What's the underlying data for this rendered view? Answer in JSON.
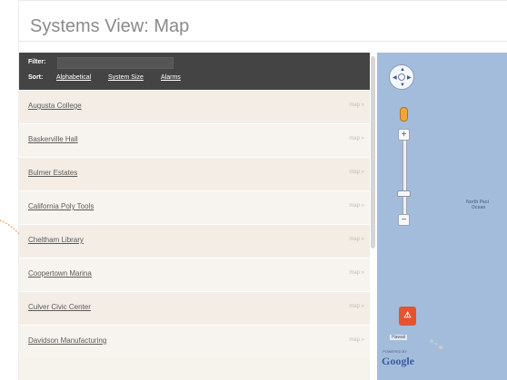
{
  "header": {
    "title": "Systems View: Map"
  },
  "filter": {
    "label": "Filter:",
    "value": ""
  },
  "sort": {
    "label": "Sort:",
    "options": [
      "Alphabetical",
      "System Size",
      "Alarms"
    ]
  },
  "systems": [
    {
      "name": "Augusta College",
      "map_label": "map »"
    },
    {
      "name": "Baskerville Hall",
      "map_label": "map »"
    },
    {
      "name": "Bulmer Estates",
      "map_label": "map »"
    },
    {
      "name": "California Poly Tools",
      "map_label": "map »"
    },
    {
      "name": "Cheltham Library",
      "map_label": "map »"
    },
    {
      "name": "Coopertown Marina",
      "map_label": "map »"
    },
    {
      "name": "Culver Civic Center",
      "map_label": "map »"
    },
    {
      "name": "Davidson Manufacturing",
      "map_label": "map »"
    }
  ],
  "map": {
    "ocean_label_line1": "North Paci",
    "ocean_label_line2": "Ocean",
    "marker_label": "Hawaii",
    "powered_by": "POWERED BY",
    "logo_text": "Google",
    "alert_icon": "warning-icon",
    "colors": {
      "water": "#a4bcdc",
      "alert": "#e5532f"
    }
  },
  "colors": {
    "filter_bar": "#444444",
    "row_background": "#f3ede5",
    "title_text": "#8a8a8a"
  }
}
